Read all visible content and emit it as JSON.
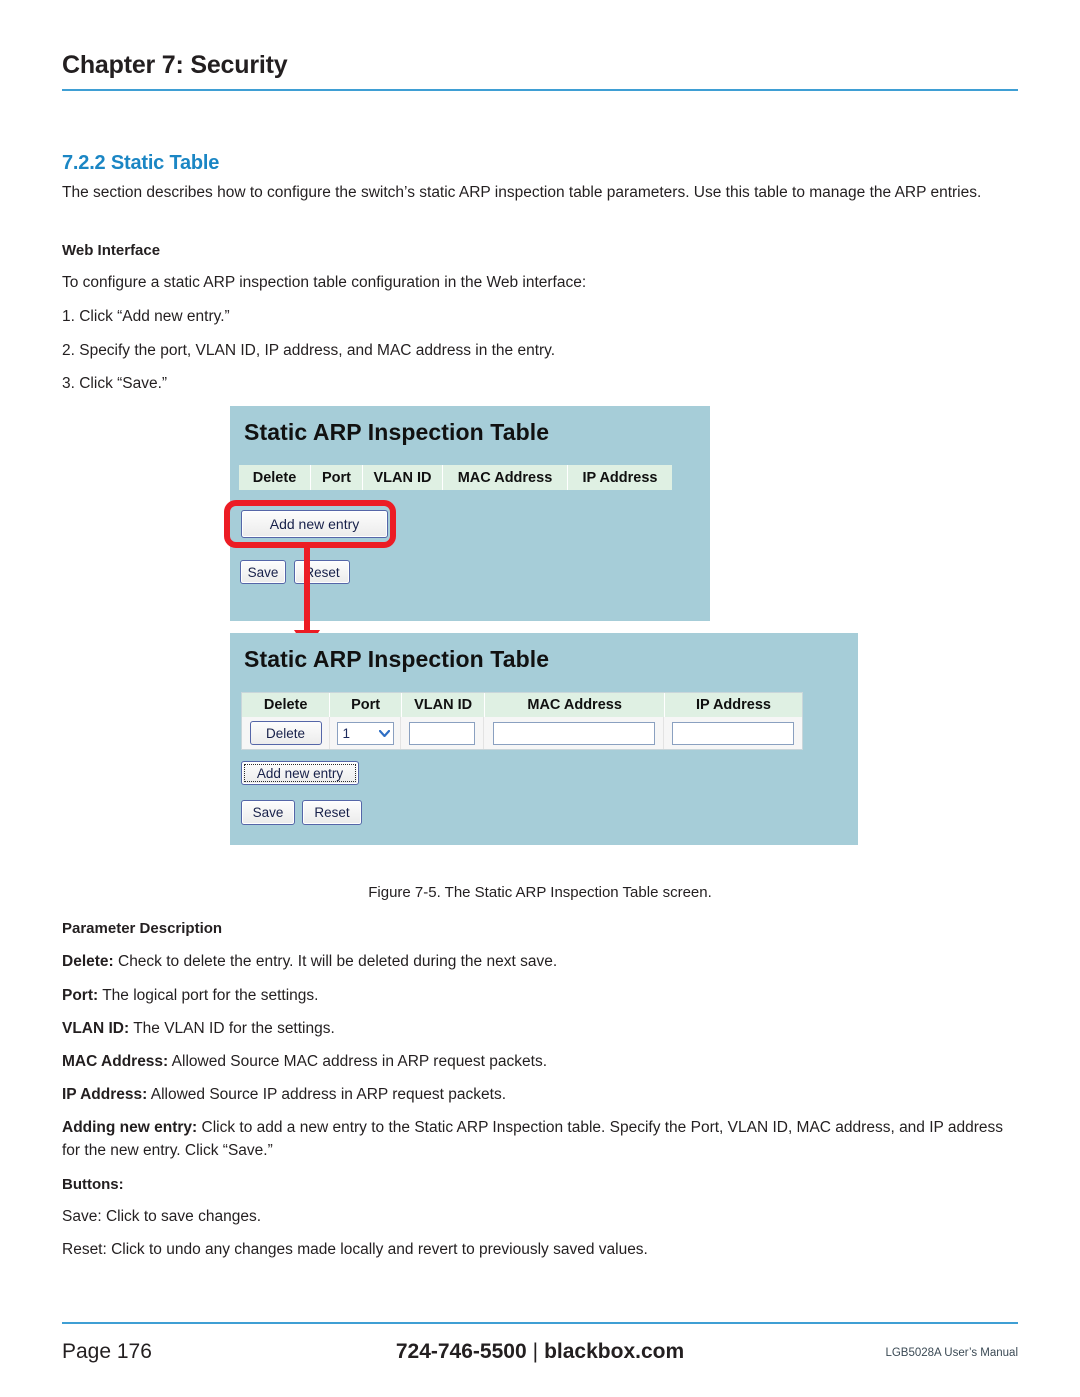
{
  "header": {
    "chapter_title": "Chapter 7: Security",
    "rule_color": "#3f9fd4"
  },
  "section": {
    "heading": "7.2.2 Static Table",
    "heading_color": "#1b86c4",
    "intro": "The section describes how to configure the switch’s static ARP inspection table parameters. Use this table to manage the ARP entries.",
    "web_interface_label": "Web Interface",
    "to_configure": "To configure a static ARP inspection table configuration in the Web interface:",
    "steps": [
      "1. Click “Add new entry.”",
      "2. Specify the port, VLAN ID, IP address, and MAC address in the entry.",
      "3. Click “Save.”"
    ]
  },
  "figure": {
    "caption": "Figure 7-5. The Static ARP Inspection Table screen.",
    "panel_bg": "#a6cdd8",
    "header_cell_bg": "#dff0e3",
    "annotation_color": "#ec1c24",
    "panel_one": {
      "title": "Static ARP Inspection Table",
      "columns": [
        "Delete",
        "Port",
        "VLAN ID",
        "MAC Address",
        "IP Address"
      ],
      "add_new_entry": "Add new entry",
      "save": "Save",
      "reset": "Reset"
    },
    "panel_two": {
      "title": "Static ARP Inspection Table",
      "columns": [
        "Delete",
        "Port",
        "VLAN ID",
        "MAC Address",
        "IP Address"
      ],
      "row": {
        "delete_button": "Delete",
        "port_value": "1",
        "vlan_id_value": "",
        "mac_address_value": "",
        "ip_address_value": ""
      },
      "add_new_entry": "Add new entry",
      "save": "Save",
      "reset": "Reset"
    }
  },
  "parameter_description": {
    "label": "Parameter Description",
    "items": [
      {
        "term": "Delete:",
        "text": " Check to delete the entry. It will be deleted during the next save."
      },
      {
        "term": "Port:",
        "text": " The logical port for the settings."
      },
      {
        "term": "VLAN ID:",
        "text": " The VLAN ID for the settings."
      },
      {
        "term": "MAC Address:",
        "text": " Allowed Source MAC address in ARP request packets."
      },
      {
        "term": "IP Address:",
        "text": " Allowed Source IP address in ARP request packets."
      },
      {
        "term": "Adding new entry:",
        "text": " Click to add a new entry to the Static ARP Inspection table. Specify the Port, VLAN ID, MAC address, and IP address for the new entry. Click “Save.”"
      }
    ]
  },
  "buttons_section": {
    "label": "Buttons:",
    "items": [
      "Save: Click to save changes.",
      "Reset: Click to undo any changes made locally and revert to previously saved values."
    ]
  },
  "footer": {
    "page": "Page 176",
    "phone": "724-746-5500",
    "separator": "|",
    "site": "blackbox.com",
    "manual": "LGB5028A User’s Manual"
  }
}
